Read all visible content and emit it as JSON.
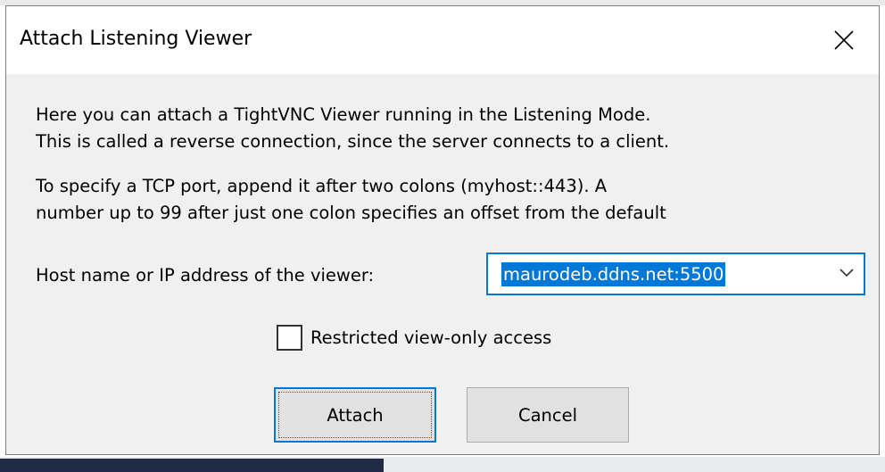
{
  "window": {
    "title": "Attach Listening Viewer",
    "close_icon": "close-icon"
  },
  "description": {
    "line1": "Here you can attach a TightVNC Viewer running in the Listening Mode.",
    "line2": "This is called a reverse connection, since the server connects to a client.",
    "line3": "To specify a TCP port, append it after two colons (myhost::443).  A",
    "line4": "number up to 99 after just one colon specifies an offset from the default"
  },
  "host": {
    "label": "Host name or IP address of the viewer:",
    "value": "maurodeb.ddns.net:5500",
    "dropdown_icon": "chevron-down-icon"
  },
  "restricted": {
    "label": "Restricted view-only access",
    "checked": false
  },
  "buttons": {
    "attach": "Attach",
    "cancel": "Cancel"
  },
  "colors": {
    "accent": "#0078d7",
    "dialog_bg": "#f0f0f0",
    "button_bg": "#e1e1e1"
  }
}
